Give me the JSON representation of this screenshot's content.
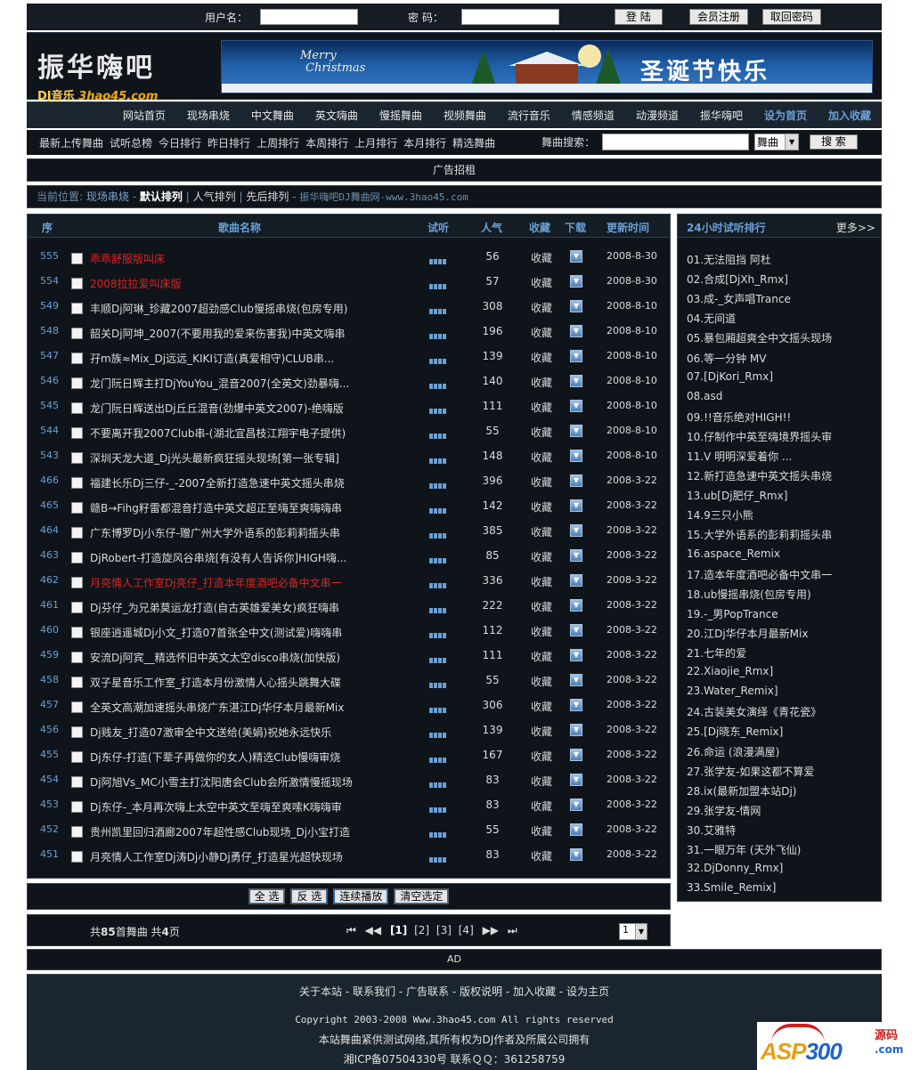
{
  "login": {
    "username_label": "用户名：",
    "password_label": "密  码：",
    "login_button": "登 陆",
    "register_button": "会员注册",
    "recover_button": "取回密码"
  },
  "logo": {
    "main": "振华嗨吧",
    "sub_dj": "DJ音乐",
    "sub_site": "3hao45.com"
  },
  "banner": {
    "merry": "Merry",
    "christmas": "Christmas",
    "greeting": "圣诞节快乐"
  },
  "nav": {
    "items": [
      "网站首页",
      "现场串烧",
      "中文舞曲",
      "英文嗨曲",
      "慢摇舞曲",
      "视频舞曲",
      "流行音乐",
      "情感频道",
      "动漫频道",
      "振华嗨吧"
    ],
    "set_home": "设为首页",
    "add_fav": "加入收藏"
  },
  "subnav": {
    "items": [
      "最新上传舞曲",
      "试听总榜",
      "今日排行",
      "昨日排行",
      "上周排行",
      "本周排行",
      "上月排行",
      "本月排行",
      "精选舞曲"
    ],
    "search_label": "舞曲搜索：",
    "search_select": "舞曲",
    "search_button": "搜 索"
  },
  "ad_top": "广告招租",
  "crumb": {
    "current": "当前位置:",
    "section": "现场串烧",
    "sep": "-",
    "default_sort": "默认排列",
    "popular_sort": "人气排列",
    "order_sort": "先后排列",
    "site": "振华嗨吧DJ舞曲网-www.3hao45.com"
  },
  "table": {
    "headers": {
      "no": "序",
      "name": "歌曲名称",
      "listen": "试听",
      "popularity": "人气",
      "fav": "收藏",
      "download": "下载",
      "updated": "更新时间"
    },
    "fav_label": "收藏",
    "rows": [
      {
        "id": "555",
        "name": "乖乖舒服版叫床",
        "pop": "56",
        "date": "2008-8-30",
        "red": true
      },
      {
        "id": "554",
        "name": "2008拉拉爱叫床版",
        "pop": "57",
        "date": "2008-8-30",
        "red": true
      },
      {
        "id": "549",
        "name": "丰顺Dj阿琳_珍藏2007超劲感Club慢摇串烧(包房专用)",
        "pop": "308",
        "date": "2008-8-10",
        "red": false
      },
      {
        "id": "548",
        "name": "韶关Dj阿坤_2007(不要用我的爱来伤害我)中英文嗨串",
        "pop": "196",
        "date": "2008-8-10",
        "red": false
      },
      {
        "id": "547",
        "name": "孖m族≈Mix_Dj远远_KIKI订造(真爱相守)CLUB串...",
        "pop": "139",
        "date": "2008-8-10",
        "red": false
      },
      {
        "id": "546",
        "name": "龙门阮日辉主打DjYouYou_混音2007(全英文)劲暴嗨...",
        "pop": "140",
        "date": "2008-8-10",
        "red": false
      },
      {
        "id": "545",
        "name": "龙门阮日辉送出Dj丘丘混音(劲爆中英文2007)-绝嗨版",
        "pop": "111",
        "date": "2008-8-10",
        "red": false
      },
      {
        "id": "544",
        "name": "不要离开我2007Club串-(湖北宜昌枝江翔宇电子提供)",
        "pop": "55",
        "date": "2008-8-10",
        "red": false
      },
      {
        "id": "543",
        "name": "深圳天龙大道_Dj光头最新疯狂摇头现场[第一张专辑]",
        "pop": "148",
        "date": "2008-8-10",
        "red": false
      },
      {
        "id": "466",
        "name": "福建长乐Dj三仔-_-2007全新打造急速中英文摇头串烧",
        "pop": "396",
        "date": "2008-3-22",
        "red": false
      },
      {
        "id": "465",
        "name": "赣B→Fihg籽雷都混音打造中英文超正至嗨至爽嗨嗨串",
        "pop": "142",
        "date": "2008-3-22",
        "red": false
      },
      {
        "id": "464",
        "name": "广东博罗Dj小东仔-赠广州大学外语系的彭莉莉摇头串",
        "pop": "385",
        "date": "2008-3-22",
        "red": false
      },
      {
        "id": "463",
        "name": "DjRobert-打造旋风谷串烧[有没有人告诉你]HIGH嗨...",
        "pop": "85",
        "date": "2008-3-22",
        "red": false
      },
      {
        "id": "462",
        "name": "月亮情人工作室Dj亮仔_打造本年度酒吧必备中文串一",
        "pop": "336",
        "date": "2008-3-22",
        "red": true
      },
      {
        "id": "461",
        "name": "Dj芬仔_为兄弟莫运龙打造(自古英雄爱美女)疯狂嗨串",
        "pop": "222",
        "date": "2008-3-22",
        "red": false
      },
      {
        "id": "460",
        "name": "银座逍遥城Dj小文_打造07首张全中文(测试爱)嗨嗨串",
        "pop": "112",
        "date": "2008-3-22",
        "red": false
      },
      {
        "id": "459",
        "name": "安流Dj阿宾__精选怀旧中英文太空disco串烧(加快版)",
        "pop": "111",
        "date": "2008-3-22",
        "red": false
      },
      {
        "id": "458",
        "name": "双子星音乐工作室_打造本月份激情人心摇头跳舞大碟",
        "pop": "55",
        "date": "2008-3-22",
        "red": false
      },
      {
        "id": "457",
        "name": "全英文高潮加速摇头串烧广东湛江Dj华仔本月最新Mix",
        "pop": "306",
        "date": "2008-3-22",
        "red": false
      },
      {
        "id": "456",
        "name": "Dj贱友_打造07激审全中文送给(美娟)祝她永远快乐",
        "pop": "139",
        "date": "2008-3-22",
        "red": false
      },
      {
        "id": "455",
        "name": "Dj东仔-打造(下辈子再做你的女人)精选Club慢嗨审烧",
        "pop": "167",
        "date": "2008-3-22",
        "red": false
      },
      {
        "id": "454",
        "name": "Dj阿旭Vs_MC小雪主打沈阳唐会Club会所激情慢摇现场",
        "pop": "83",
        "date": "2008-3-22",
        "red": false
      },
      {
        "id": "453",
        "name": "Dj东仔-_本月再次嗨上太空中英文至嗨至爽嗦K嗨嗨审",
        "pop": "83",
        "date": "2008-3-22",
        "red": false
      },
      {
        "id": "452",
        "name": "贵州凯里回归酒廊2007年超性感Club现场_Dj小宝打造",
        "pop": "55",
        "date": "2008-3-22",
        "red": false
      },
      {
        "id": "451",
        "name": "月亮情人工作室Dj涛Dj小静Dj勇仔_打造星光超快现场",
        "pop": "83",
        "date": "2008-3-22",
        "red": false
      }
    ]
  },
  "actions": {
    "select_all": "全 选",
    "invert": "反 选",
    "play": "连续播放",
    "clear": "清空选定"
  },
  "pager": {
    "summary_prefix": "共",
    "total": "85",
    "summary_mid": "首舞曲 共",
    "pages_total": "4",
    "summary_suffix": "页",
    "first": "⏮",
    "prev": "◀◀",
    "current_page": "[1]",
    "page2": "[2]",
    "page3": "[3]",
    "page4": "[4]",
    "next": "▶▶",
    "last": "⏭",
    "jump_value": "1"
  },
  "sidebar": {
    "title": "24小时试听排行",
    "more": "更多>>",
    "items": [
      "01.无法阻挡 阿杜",
      "02.合成[DjXh_Rmx]",
      "03.成-_女声唱Trance",
      "04.无间道",
      "05.暴包厢超爽全中文摇头现场",
      "06.等一分钟 MV",
      "07.[DjKori_Rmx]",
      "08.asd",
      "09.!!音乐绝对HIGH!!",
      "10.仔制作中英至嗨境界摇头审",
      "11.V 明明深爱着你 ...",
      "12.新打造急速中英文摇头串烧",
      "13.ub[Dj肥仔_Rmx]",
      "14.9三只小熊",
      "15.大学外语系的彭莉莉摇头串",
      "16.aspace_Remix",
      "17.造本年度酒吧必备中文串一",
      "18.ub慢摇串烧(包房专用)",
      "19.-_男PopTrance",
      "20.江Dj华仔本月最新Mix",
      "21.七年的爱",
      "22.Xiaojie_Rmx]",
      "23.Water_Remix]",
      "24.古装美女演绎《青花瓷》",
      "25.[Dj晓东_Remix]",
      "26.命运 (浪漫满屋)",
      "27.张学友-如果这都不算爱",
      "28.ix(最新加盟本站Dj)",
      "29.张学友-情网",
      "30.艾雅特",
      "31.一眼万年 (天外飞仙)",
      "32.DjDonny_Rmx]",
      "33.Smile_Remix]"
    ]
  },
  "ad_bottom": "AD",
  "footer": {
    "links": [
      "关于本站",
      "联系我们",
      "广告联系",
      "版权说明",
      "加入收藏",
      "设为主页"
    ],
    "sep": " - ",
    "copyright": "Copyright 2003-2008 Www.3hao45.com All rights reserved",
    "note": "本站舞曲紧供测试网络,其所有权为DJ作者及所属公司拥有",
    "icp": "湘ICP备07504330号 联系ＱＱ：361258759"
  },
  "watermark": {
    "asp": "ASP",
    "num": "300",
    "code": "源码",
    "com": ".com"
  }
}
